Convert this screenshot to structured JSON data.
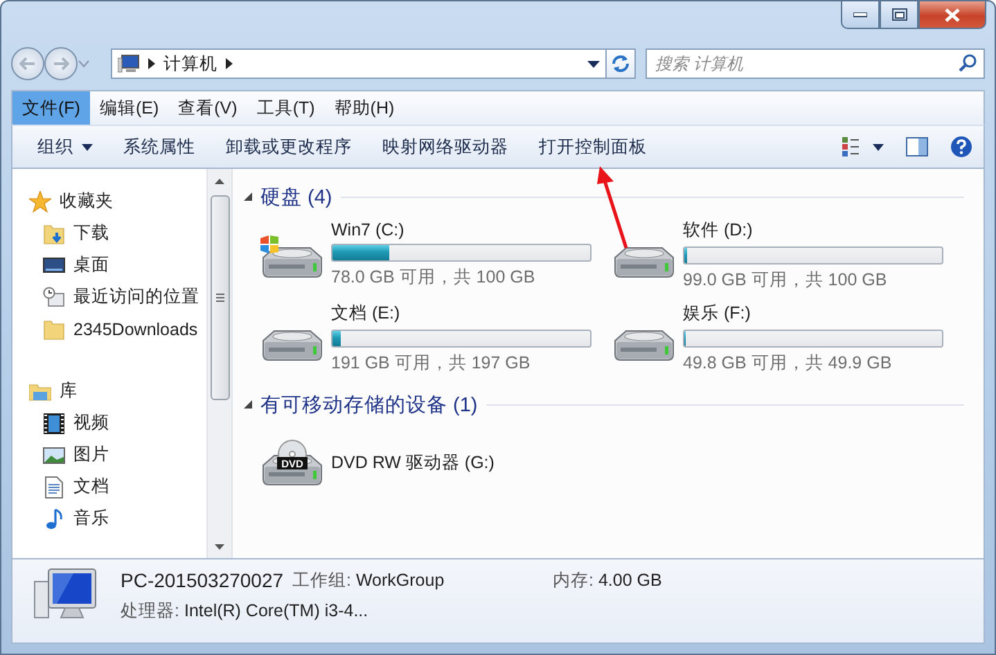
{
  "address_bar": {
    "path": [
      "计算机"
    ]
  },
  "search": {
    "placeholder": "搜索 计算机"
  },
  "menu": [
    {
      "label": "文件(F)",
      "selected": true
    },
    {
      "label": "编辑(E)",
      "selected": false
    },
    {
      "label": "查看(V)",
      "selected": false
    },
    {
      "label": "工具(T)",
      "selected": false
    },
    {
      "label": "帮助(H)",
      "selected": false
    }
  ],
  "toolbar": [
    {
      "label": "组织",
      "dropdown": true
    },
    {
      "label": "系统属性",
      "dropdown": false
    },
    {
      "label": "卸载或更改程序",
      "dropdown": false
    },
    {
      "label": "映射网络驱动器",
      "dropdown": false
    },
    {
      "label": "打开控制面板",
      "dropdown": false
    }
  ],
  "navigation": [
    {
      "label": "收藏夹",
      "kind": "star",
      "children": [
        {
          "label": "下载",
          "kind": "download"
        },
        {
          "label": "桌面",
          "kind": "desktop"
        },
        {
          "label": "最近访问的位置",
          "kind": "recent"
        },
        {
          "label": "2345Downloads",
          "kind": "folder"
        }
      ]
    },
    {
      "label": "库",
      "kind": "library",
      "children": [
        {
          "label": "视频",
          "kind": "video"
        },
        {
          "label": "图片",
          "kind": "picture"
        },
        {
          "label": "文档",
          "kind": "document"
        },
        {
          "label": "音乐",
          "kind": "music"
        }
      ]
    }
  ],
  "groups": [
    {
      "title": "硬盘 (4)",
      "expanded": true,
      "drives": [
        {
          "name": "Win7 (C:)",
          "kind": "system",
          "level": 0.22,
          "space": "78.0 GB 可用，共 100 GB"
        },
        {
          "name": "软件 (D:)",
          "kind": "disk",
          "level": 0.01,
          "space": "99.0 GB 可用，共 100 GB"
        },
        {
          "name": "文档 (E:)",
          "kind": "disk",
          "level": 0.03,
          "space": "191 GB 可用，共 197 GB"
        },
        {
          "name": "娱乐 (F:)",
          "kind": "disk",
          "level": 0.005,
          "space": "49.8 GB 可用，共 49.9 GB"
        }
      ]
    },
    {
      "title": "有可移动存储的设备 (1)",
      "expanded": true,
      "drives": [
        {
          "name": "DVD RW 驱动器 (G:)",
          "kind": "dvd",
          "icon_label": "DVD"
        }
      ]
    }
  ],
  "details": {
    "name": "PC-201503270027",
    "properties": [
      {
        "label": "工作组:",
        "value": "WorkGroup"
      },
      {
        "label": "内存:",
        "value": "4.00 GB"
      },
      {
        "label": "处理器:",
        "value": "Intel(R) Core(TM) i3-4..."
      }
    ]
  }
}
